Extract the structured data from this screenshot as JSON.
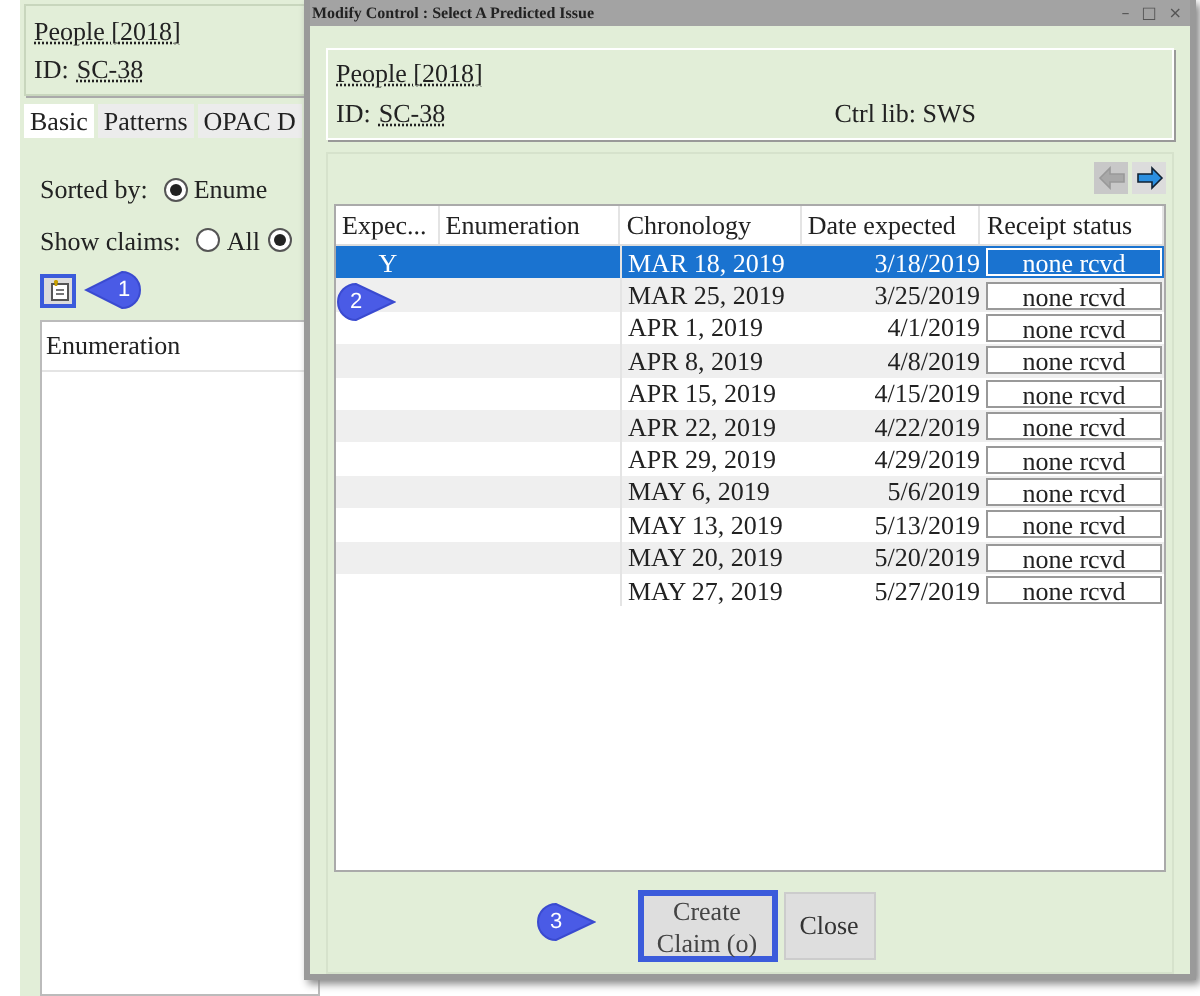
{
  "background_window": {
    "title": "People [2018]",
    "id_label": "ID:",
    "id_value": "SC-38",
    "tabs": [
      {
        "label": "Basic",
        "selected": true
      },
      {
        "label": "Patterns",
        "selected": false
      },
      {
        "label": "OPAC D",
        "selected": false
      }
    ],
    "sorted_by": {
      "label": "Sorted by:",
      "options": [
        {
          "label": "Enume",
          "selected": true
        }
      ]
    },
    "show_claims": {
      "label": "Show claims:",
      "options": [
        {
          "label": "All",
          "selected": false
        },
        {
          "selected": true
        }
      ]
    },
    "list_header": "Enumeration"
  },
  "dialog": {
    "title": "Modify Control : Select A Predicted Issue",
    "window_controls": [
      "–",
      "□",
      "×"
    ],
    "record_title": "People [2018]",
    "id_label": "ID:",
    "id_value": "SC-38",
    "ctrl_lib": "Ctrl lib: SWS",
    "prev_disabled": true,
    "next_disabled": false,
    "columns": [
      "Expec...",
      "Enumeration",
      "Chronology",
      "Date expected",
      "Receipt status"
    ],
    "rows": [
      {
        "expected": "Y",
        "chronology": "MAR 18, 2019",
        "date_expected": "3/18/2019",
        "receipt_status": "none rcvd",
        "selected": true
      },
      {
        "chronology": "MAR 25, 2019",
        "date_expected": "3/25/2019",
        "receipt_status": "none rcvd",
        "selected": false
      },
      {
        "chronology": "APR 1, 2019",
        "date_expected": "4/1/2019",
        "receipt_status": "none rcvd",
        "selected": false
      },
      {
        "chronology": "APR 8, 2019",
        "date_expected": "4/8/2019",
        "receipt_status": "none rcvd",
        "selected": false
      },
      {
        "chronology": "APR 15, 2019",
        "date_expected": "4/15/2019",
        "receipt_status": "none rcvd",
        "selected": false
      },
      {
        "chronology": "APR 22, 2019",
        "date_expected": "4/22/2019",
        "receipt_status": "none rcvd",
        "selected": false
      },
      {
        "chronology": "APR 29, 2019",
        "date_expected": "4/29/2019",
        "receipt_status": "none rcvd",
        "selected": false
      },
      {
        "chronology": "MAY 6, 2019",
        "date_expected": "5/6/2019",
        "receipt_status": "none rcvd",
        "selected": false
      },
      {
        "chronology": "MAY 13, 2019",
        "date_expected": "5/13/2019",
        "receipt_status": "none rcvd",
        "selected": false
      },
      {
        "chronology": "MAY 20, 2019",
        "date_expected": "5/20/2019",
        "receipt_status": "none rcvd",
        "selected": false
      },
      {
        "chronology": "MAY 27, 2019",
        "date_expected": "5/27/2019",
        "receipt_status": "none rcvd",
        "selected": false
      }
    ],
    "buttons": [
      {
        "kind": "create",
        "label": "Create Claim (o)",
        "highlighted": true
      },
      {
        "kind": "close",
        "label": "Close",
        "highlighted": false
      }
    ]
  },
  "callouts": [
    "1",
    "2",
    "3"
  ]
}
